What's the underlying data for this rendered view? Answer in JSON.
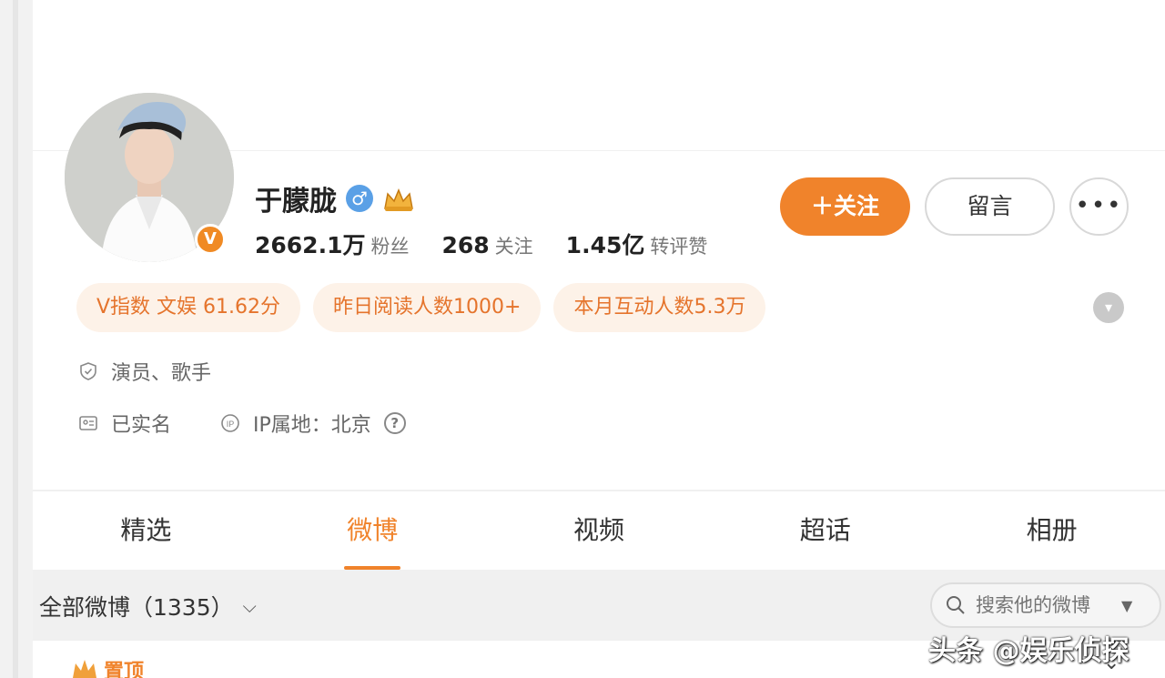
{
  "profile": {
    "name": "于朦胧",
    "gender_icon": "male-icon",
    "verified_badge": "V",
    "stats": [
      {
        "value": "2662.1万",
        "label": "粉丝"
      },
      {
        "value": "268",
        "label": "关注"
      },
      {
        "value": "1.45亿",
        "label": "转评赞"
      }
    ],
    "actions": {
      "follow": "＋关注",
      "message": "留言",
      "more": "•••"
    },
    "tags": [
      "V指数 文娱 61.62分",
      "昨日阅读人数1000+",
      "本月互动人数5.3万"
    ],
    "occupation": "演员、歌手",
    "real_name": "已实名",
    "ip_location": "IP属地：北京",
    "accent_color": "#f0832b"
  },
  "tabs": [
    {
      "label": "精选",
      "active": false
    },
    {
      "label": "微博",
      "active": true
    },
    {
      "label": "视频",
      "active": false
    },
    {
      "label": "超话",
      "active": false
    },
    {
      "label": "相册",
      "active": false
    }
  ],
  "feed": {
    "title": "全部微博（1335）",
    "search_placeholder": "搜索他的微博",
    "pinned_label": "置顶"
  },
  "watermark": "头条 @娱乐侦探"
}
